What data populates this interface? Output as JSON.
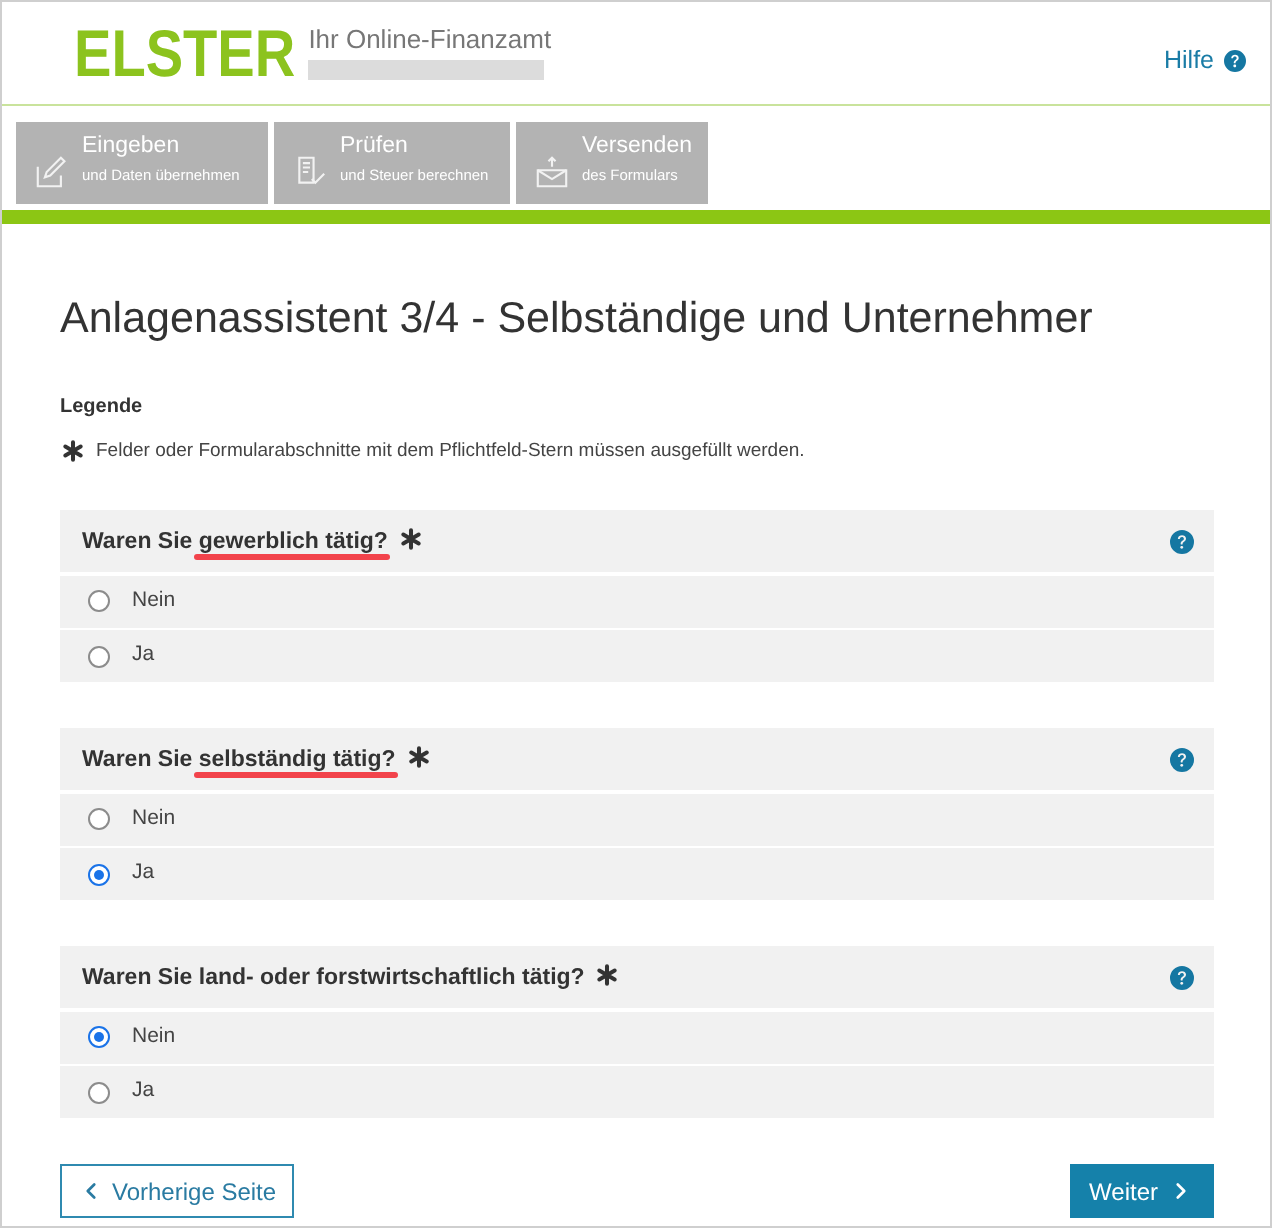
{
  "header": {
    "logo": "ELSTER",
    "tagline": "Ihr Online-Finanzamt",
    "help_link": "Hilfe"
  },
  "steps": [
    {
      "kind": "edit",
      "title": "Eingeben",
      "subtitle": "und Daten übernehmen"
    },
    {
      "kind": "check",
      "title": "Prüfen",
      "subtitle": "und Steuer berechnen"
    },
    {
      "kind": "send",
      "title": "Versenden",
      "subtitle": "des Formulars"
    }
  ],
  "page_title": "Anlagenassistent 3/4 - Selbständige und Unternehmer",
  "legend": {
    "heading": "Legende",
    "text": "Felder oder Formularabschnitte mit dem Pflichtfeld-Stern müssen ausgefüllt werden."
  },
  "questions": [
    {
      "parts": [
        {
          "text": "Waren Sie ",
          "underlined": false
        },
        {
          "text": "gewerblich tätig?",
          "underlined": true
        }
      ],
      "required": true,
      "options": [
        {
          "label": "Nein",
          "selected": false
        },
        {
          "label": "Ja",
          "selected": false
        }
      ]
    },
    {
      "parts": [
        {
          "text": "Waren Sie ",
          "underlined": false
        },
        {
          "text": "selbständig tätig?",
          "underlined": true
        }
      ],
      "required": true,
      "options": [
        {
          "label": "Nein",
          "selected": false
        },
        {
          "label": "Ja",
          "selected": true
        }
      ]
    },
    {
      "parts": [
        {
          "text": "Waren Sie land- oder forstwirtschaftlich tätig?",
          "underlined": false
        }
      ],
      "required": true,
      "options": [
        {
          "label": "Nein",
          "selected": true
        },
        {
          "label": "Ja",
          "selected": false
        }
      ]
    }
  ],
  "buttons": {
    "back": "Vorherige Seite",
    "next": "Weiter"
  }
}
